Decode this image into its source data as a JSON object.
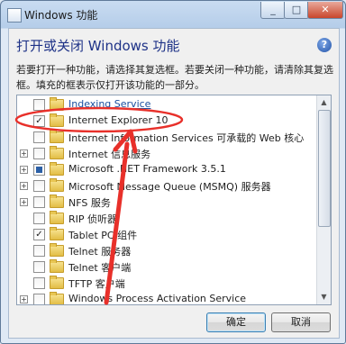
{
  "window": {
    "title": "Windows 功能"
  },
  "heading": "打开或关闭 Windows 功能",
  "help_label": "?",
  "description": "若要打开一种功能，请选择其复选框。若要关闭一种功能，请清除其复选框。填充的框表示仅打开该功能的一部分。",
  "features": [
    {
      "label": "Indexing Service",
      "expandable": false,
      "state": "unchecked"
    },
    {
      "label": "Internet Explorer 10",
      "expandable": false,
      "state": "checked"
    },
    {
      "label": "Internet Information Services 可承载的 Web 核心",
      "expandable": false,
      "state": "unchecked"
    },
    {
      "label": "Internet 信息服务",
      "expandable": true,
      "state": "unchecked"
    },
    {
      "label": "Microsoft .NET Framework 3.5.1",
      "expandable": true,
      "state": "partial"
    },
    {
      "label": "Microsoft Message Queue (MSMQ) 服务器",
      "expandable": true,
      "state": "unchecked"
    },
    {
      "label": "NFS 服务",
      "expandable": true,
      "state": "unchecked"
    },
    {
      "label": "RIP 侦听器",
      "expandable": false,
      "state": "unchecked"
    },
    {
      "label": "Tablet PC 组件",
      "expandable": false,
      "state": "checked"
    },
    {
      "label": "Telnet 服务器",
      "expandable": false,
      "state": "unchecked"
    },
    {
      "label": "Telnet 客户端",
      "expandable": false,
      "state": "unchecked"
    },
    {
      "label": "TFTP 客户端",
      "expandable": false,
      "state": "unchecked"
    },
    {
      "label": "Windows Process Activation Service",
      "expandable": true,
      "state": "unchecked"
    }
  ],
  "buttons": {
    "ok": "确定",
    "cancel": "取消"
  },
  "annotation": {
    "color": "#e8302a",
    "highlighted_item": "Internet Explorer 10"
  }
}
